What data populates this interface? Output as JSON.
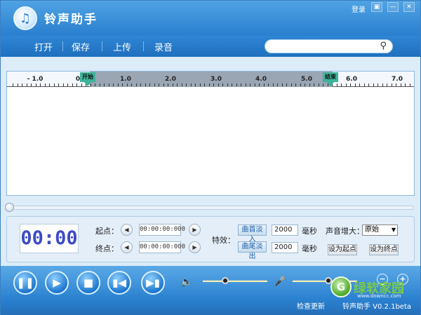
{
  "title_bar": {
    "app_title": "铃声助手",
    "login": "登录",
    "menu_glyph": "▣",
    "minimize_glyph": "—",
    "close_glyph": "✕"
  },
  "menu": {
    "items": [
      "打开",
      "保存",
      "上传",
      "录音"
    ],
    "search": {
      "value": "",
      "placeholder": ""
    }
  },
  "timeline": {
    "ticks": [
      "- 1.0",
      "0",
      "1.0",
      "2.0",
      "3.0",
      "4.0",
      "5.0",
      "6.0",
      "7.0"
    ],
    "start_marker": "开始",
    "end_marker": "结束",
    "selection_color": "#9aa6b3",
    "marker_color": "#3fb39a"
  },
  "controls": {
    "time_display": "00:00",
    "start_label": "起点：",
    "end_label": "终点：",
    "start_time": "00:00:00:000",
    "end_time": "00:00:00:000",
    "effect_label": "特效：",
    "fade_in": "曲首淡入",
    "fade_out": "曲尾淡出",
    "fade_in_ms": "2000",
    "fade_out_ms": "2000",
    "ms_unit": "毫秒",
    "volume_boost_label": "声音增大：",
    "volume_boost_value": "原始",
    "set_start": "设为起点",
    "set_end": "设为终点"
  },
  "playback": {
    "buttons": [
      "pause-icon",
      "play-icon",
      "stop-icon",
      "previous-icon",
      "next-icon"
    ],
    "volume_level": 0.35,
    "mic_level": 0.55
  },
  "status": {
    "check_update": "检查更新",
    "version": "铃声助手 V0.2.1beta"
  },
  "watermark": {
    "logo_glyph": "G",
    "brand": "绿软家园",
    "url": "www.downcc.com"
  }
}
